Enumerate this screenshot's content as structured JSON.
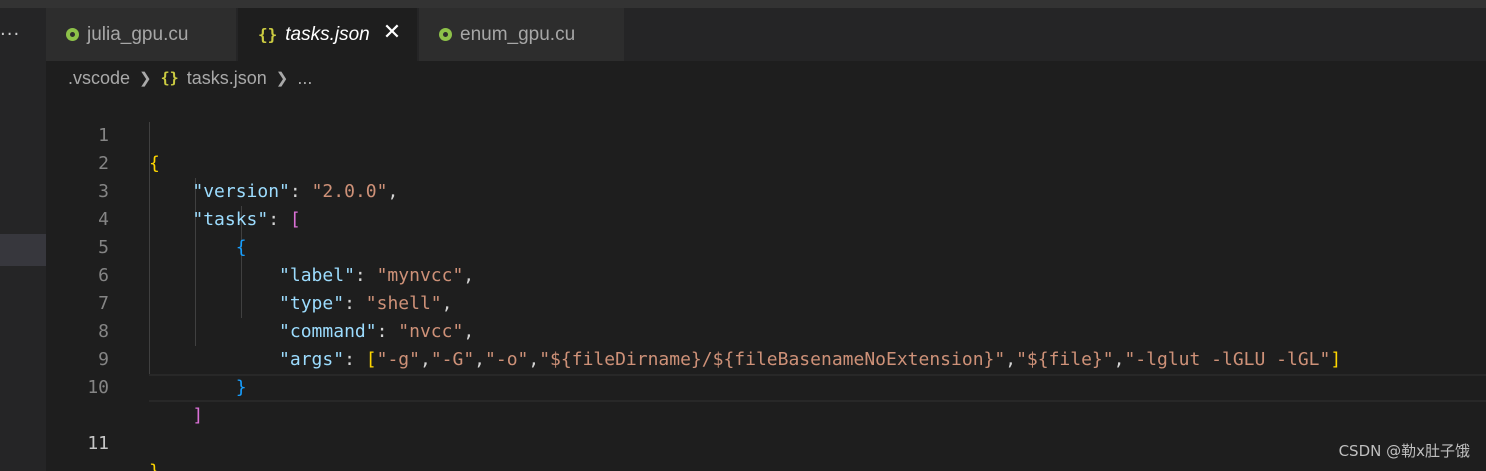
{
  "tabs": [
    {
      "label": "julia_gpu.cu",
      "icon": "cuda-file-icon",
      "active": false
    },
    {
      "label": "tasks.json",
      "icon": "json-braces-icon",
      "active": true
    },
    {
      "label": "enum_gpu.cu",
      "icon": "cuda-file-icon",
      "active": false
    }
  ],
  "more_actions": "···",
  "close_glyph": "✕",
  "breadcrumb": {
    "folder": ".vscode",
    "file_icon": "{}",
    "file": "tasks.json",
    "ellipsis": "..."
  },
  "editor": {
    "current_line": 11,
    "line_numbers": [
      "1",
      "2",
      "3",
      "4",
      "5",
      "6",
      "7",
      "8",
      "9",
      "10",
      "11"
    ],
    "code": {
      "open_brace": "{",
      "version_key": "\"version\"",
      "version_value": "\"2.0.0\"",
      "tasks_key": "\"tasks\"",
      "tasks_open": "[",
      "obj_open": "{",
      "label_key": "\"label\"",
      "label_value": "\"mynvcc\"",
      "type_key": "\"type\"",
      "type_value": "\"shell\"",
      "command_key": "\"command\"",
      "command_value": "\"nvcc\"",
      "args_key": "\"args\"",
      "args_open": "[",
      "args_values": [
        "\"-g\"",
        "\"-G\"",
        "\"-o\"",
        "\"${fileDirname}/${fileBasenameNoExtension}\"",
        "\"${file}\"",
        "\"-lglut -lGLU -lGL\""
      ],
      "args_close": "]",
      "obj_close": "}",
      "tasks_close": "]",
      "close_brace": "}"
    }
  },
  "watermark": "CSDN @勒x肚子饿",
  "colors": {
    "background": "#1e1e1e",
    "key": "#9cdcfe",
    "string": "#ce9178",
    "bracket_level1": "#ffd700",
    "bracket_level2": "#da70d6",
    "bracket_level3": "#179fff"
  }
}
